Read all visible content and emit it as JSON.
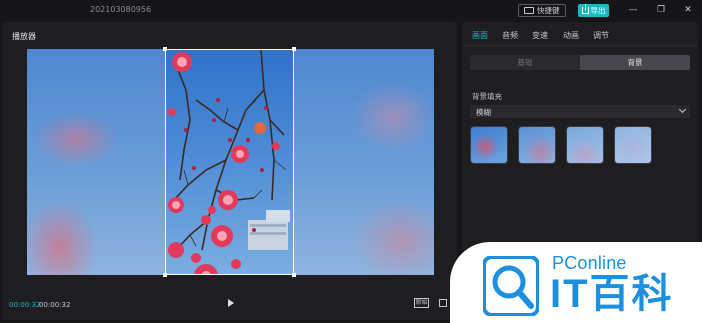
{
  "window": {
    "project_title": "202103080956",
    "shortcut_label": "快捷键",
    "export_label": "导出",
    "minimize_icon": "minimize-icon",
    "maximize_icon": "maximize-icon",
    "close_icon": "close-icon"
  },
  "player": {
    "title": "播放器",
    "time_current": "00:00:32",
    "time_total": "00:00:32",
    "ratio_label": "原始"
  },
  "right_panel": {
    "tabs": [
      {
        "label": "画面",
        "active": true
      },
      {
        "label": "音频",
        "active": false
      },
      {
        "label": "变速",
        "active": false
      },
      {
        "label": "动画",
        "active": false
      },
      {
        "label": "调节",
        "active": false
      }
    ],
    "segments": [
      {
        "label": "基础",
        "active": false
      },
      {
        "label": "背景",
        "active": true
      }
    ],
    "section_label": "背景填充",
    "select_value": "模糊",
    "thumbnails": [
      "blur-1",
      "blur-2",
      "blur-3",
      "blur-4"
    ]
  },
  "watermark": {
    "brand_pc": "PConline",
    "brand_it": "IT百科"
  },
  "colors": {
    "accent": "#1fb5c4",
    "background": "#161618",
    "panel": "#1e1e21",
    "watermark_blue": "#1c8fe0"
  }
}
